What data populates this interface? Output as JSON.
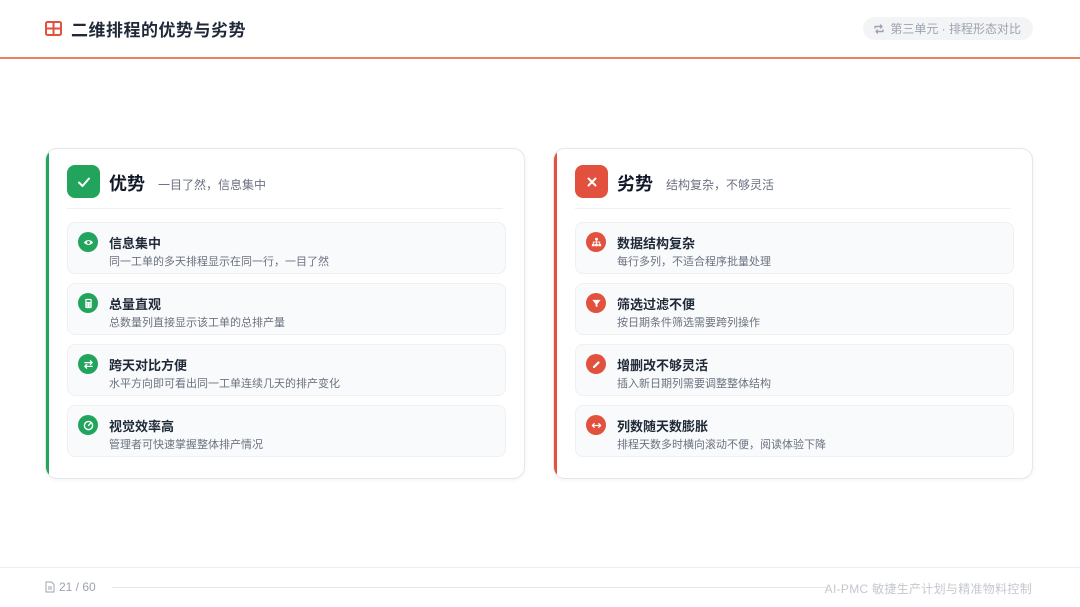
{
  "header": {
    "title": "二维排程的优势与劣势",
    "title_icon": "grid-icon",
    "section_pill": "第三单元 · 排程形态对比",
    "section_icon": "repeat-icon"
  },
  "pros": {
    "title": "优势",
    "subtitle": "一目了然，信息集中",
    "icon": "check-icon",
    "accent": "#22a45d",
    "items": [
      {
        "icon": "eye-icon",
        "title": "信息集中",
        "desc": "同一工单的多天排程显示在同一行，一目了然"
      },
      {
        "icon": "calculator-icon",
        "title": "总量直观",
        "desc": "总数量列直接显示该工单的总排产量"
      },
      {
        "icon": "exchange-icon",
        "title": "跨天对比方便",
        "desc": "水平方向即可看出同一工单连续几天的排产变化"
      },
      {
        "icon": "gauge-icon",
        "title": "视觉效率高",
        "desc": "管理者可快速掌握整体排产情况"
      }
    ]
  },
  "cons": {
    "title": "劣势",
    "subtitle": "结构复杂，不够灵活",
    "icon": "close-icon",
    "accent": "#e2513d",
    "items": [
      {
        "icon": "hierarchy-icon",
        "title": "数据结构复杂",
        "desc": "每行多列，不适合程序批量处理"
      },
      {
        "icon": "filter-icon",
        "title": "筛选过滤不便",
        "desc": "按日期条件筛选需要跨列操作"
      },
      {
        "icon": "pencil-icon",
        "title": "增删改不够灵活",
        "desc": "插入新日期列需要调整整体结构"
      },
      {
        "icon": "horizontal-arrows-icon",
        "title": "列数随天数膨胀",
        "desc": "排程天数多时横向滚动不便，阅读体验下降"
      }
    ]
  },
  "footer": {
    "page_icon": "document-icon",
    "page_number": "21 / 60",
    "brand": "AI-PMC 敏捷生产计划与精准物料控制"
  }
}
